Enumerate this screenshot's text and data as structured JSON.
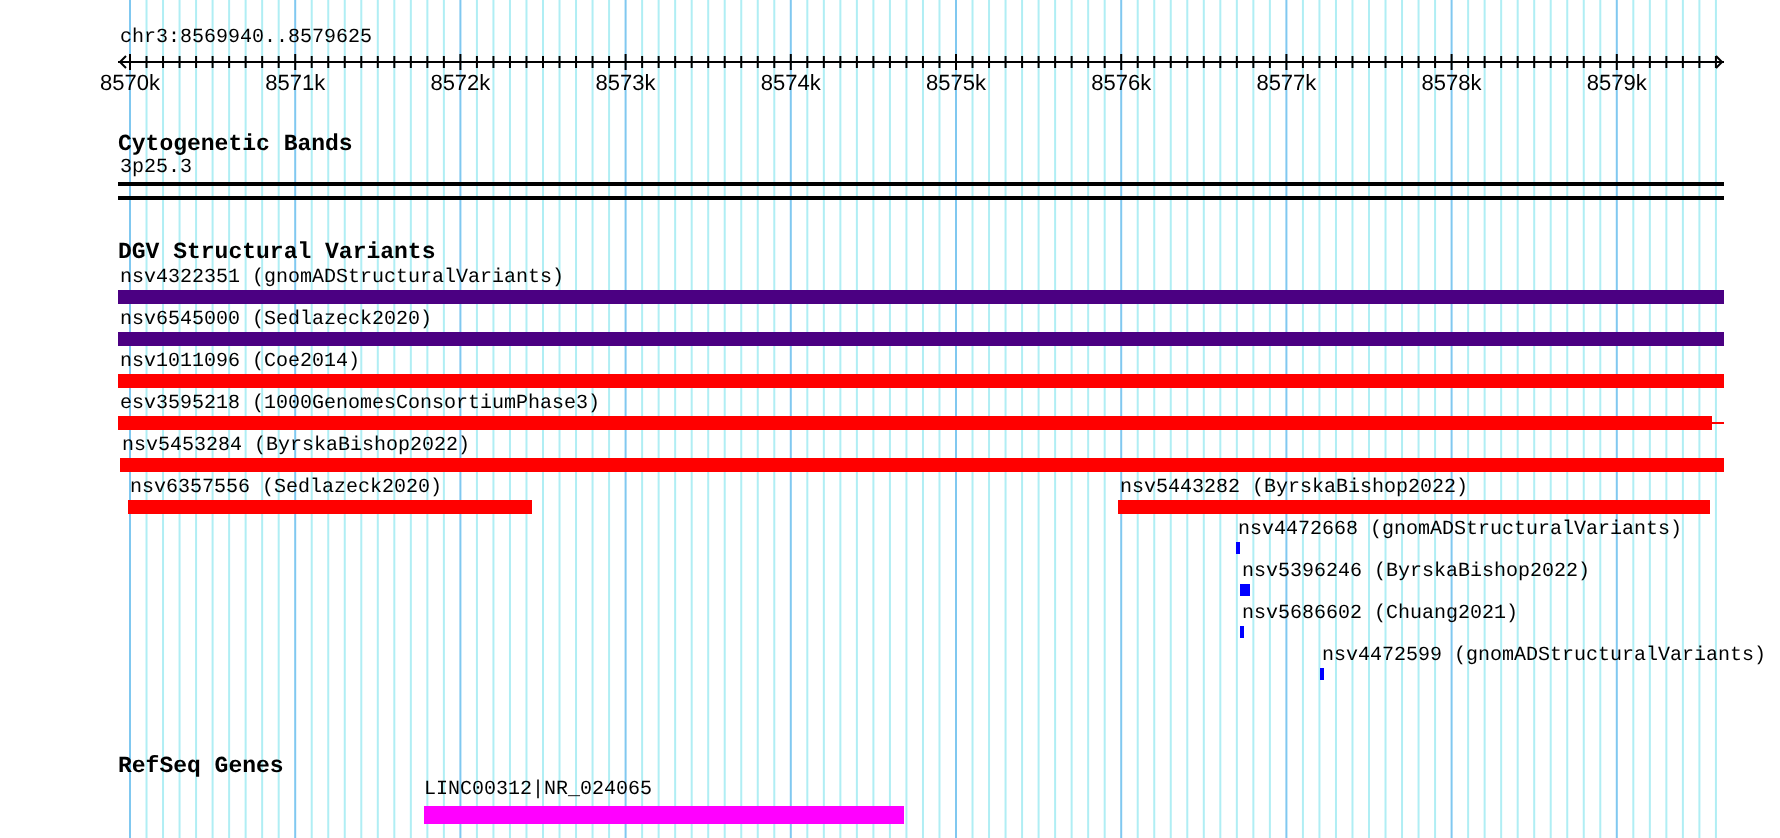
{
  "location": "chr3:8569940..8579625",
  "ruler": {
    "ticks": [
      "8570k",
      "8571k",
      "8572k",
      "8573k",
      "8574k",
      "8575k",
      "8576k",
      "8577k",
      "8578k",
      "8579k"
    ]
  },
  "tracks": [
    {
      "kind": "bands",
      "title": "Cytogenetic Bands",
      "features": [
        {
          "label": "3p25.3"
        }
      ]
    },
    {
      "kind": "variants",
      "title": "DGV Structural Variants",
      "rows": [
        [
          {
            "label": "nsv4322351 (gnomADStructuralVariants)",
            "color": "#4b0082"
          }
        ],
        [
          {
            "label": "nsv6545000 (Sedlazeck2020)",
            "color": "#4b0082"
          }
        ],
        [
          {
            "label": "nsv1011096 (Coe2014)",
            "color": "#ff0000"
          }
        ],
        [
          {
            "label": "esv3595218 (1000GenomesConsortiumPhase3)",
            "color": "#ff0000"
          }
        ],
        [
          {
            "label": "nsv5453284 (ByrskaBishop2022)",
            "color": "#ff0000"
          }
        ],
        [
          {
            "label": "nsv6357556 (Sedlazeck2020)",
            "color": "#ff0000"
          },
          {
            "label": "nsv5443282 (ByrskaBishop2022)",
            "color": "#ff0000"
          }
        ],
        [
          {
            "label": "nsv4472668 (gnomADStructuralVariants)",
            "color": "#0000ff"
          }
        ],
        [
          {
            "label": "nsv5396246 (ByrskaBishop2022)",
            "color": "#0000ff"
          }
        ],
        [
          {
            "label": "nsv5686602 (Chuang2021)",
            "color": "#0000ff"
          }
        ],
        [
          {
            "label": "nsv4472599 (gnomADStructuralVariants)",
            "color": "#0000ff"
          }
        ]
      ]
    },
    {
      "kind": "genes",
      "title": "RefSeq Genes",
      "features": [
        {
          "label": "LINC00312|NR_024065",
          "color": "#ff00ff"
        }
      ]
    }
  ]
}
